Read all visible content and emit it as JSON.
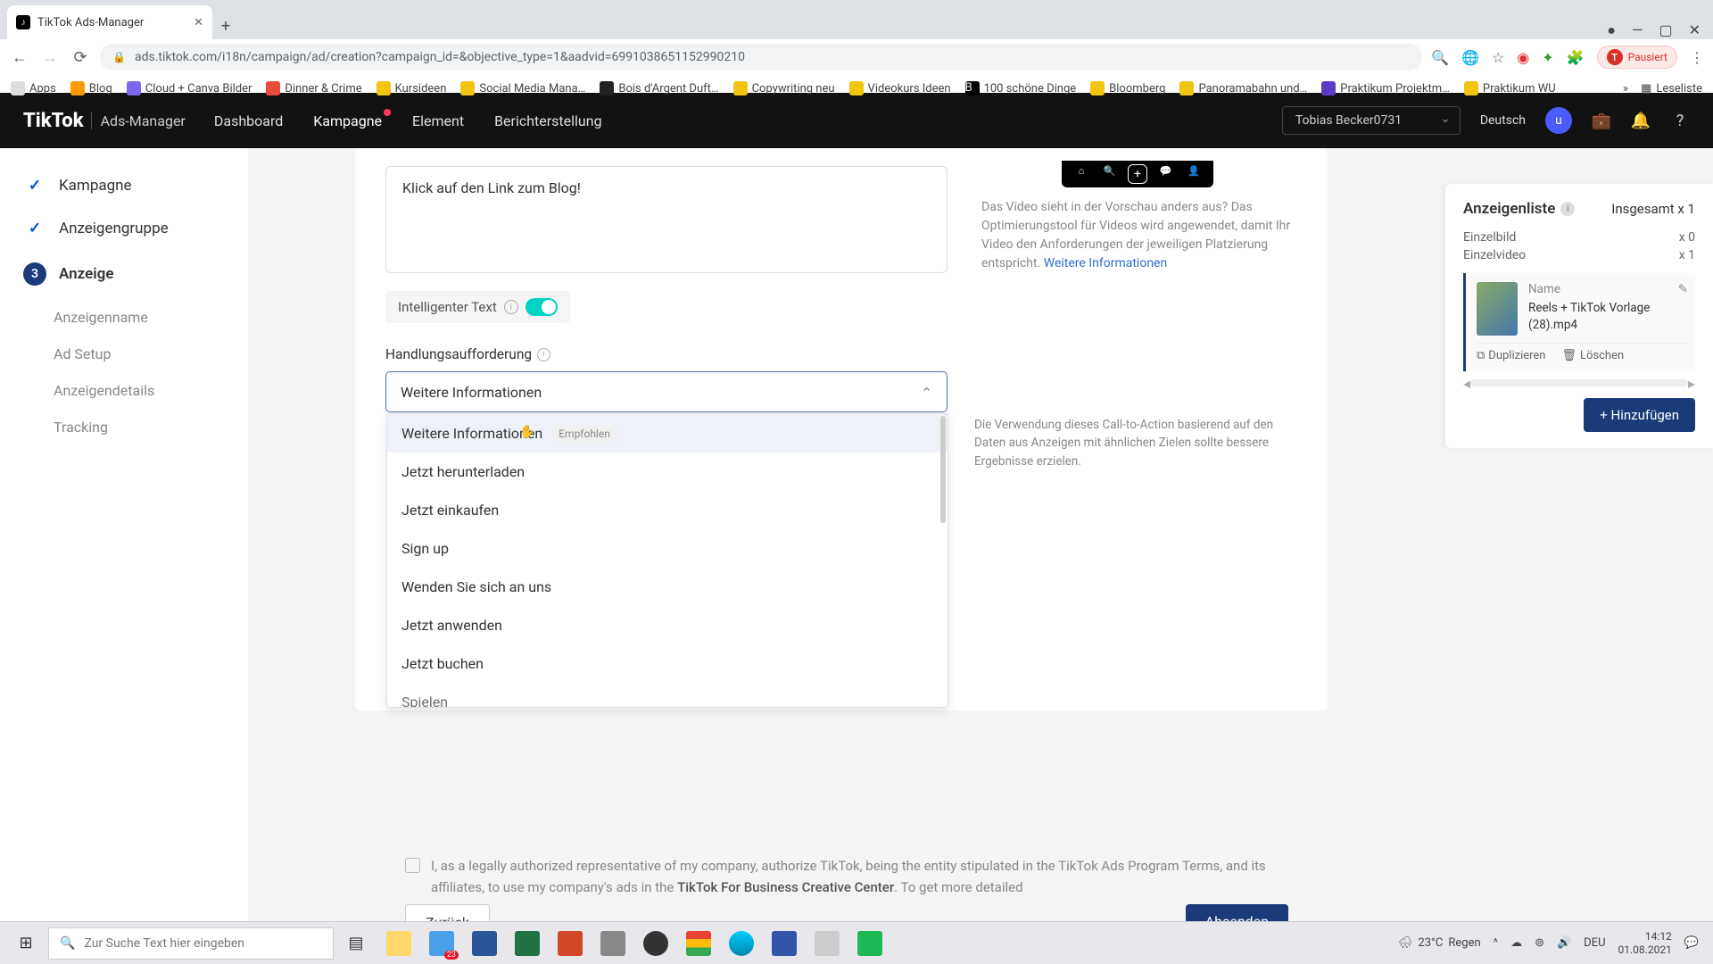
{
  "browser": {
    "tab_title": "TikTok Ads-Manager",
    "url": "ads.tiktok.com/i18n/campaign/ad/creation?campaign_id=&objective_type=1&aadvid=6991038651152990210",
    "profile_status": "Pausiert",
    "bookmarks": [
      "Apps",
      "Blog",
      "Cloud + Canva Bilder",
      "Dinner & Crime",
      "Kursideen",
      "Social Media Mana…",
      "Bois d'Argent Duft…",
      "Copywriting neu",
      "Videokurs Ideen",
      "100 schöne Dinge",
      "Bloomberg",
      "Panoramabahn und…",
      "Praktikum Projektm…",
      "Praktikum WU"
    ],
    "reading_list": "Leseliste"
  },
  "header": {
    "logo_main": "TikTok",
    "logo_sub": "Ads-Manager",
    "nav": [
      "Dashboard",
      "Kampagne",
      "Element",
      "Berichterstellung"
    ],
    "account": "Tobias Becker0731",
    "language": "Deutsch",
    "avatar_initial": "u"
  },
  "sidebar": {
    "steps": [
      {
        "label": "Kampagne",
        "state": "done"
      },
      {
        "label": "Anzeigengruppe",
        "state": "done"
      },
      {
        "label": "Anzeige",
        "state": "active",
        "num": "3"
      }
    ],
    "subs": [
      "Anzeigenname",
      "Ad Setup",
      "Anzeigendetails",
      "Tracking"
    ]
  },
  "form": {
    "text_value": "Klick auf den Link zum Blog!",
    "smart_text_label": "Intelligenter Text",
    "cta_label": "Handlungsaufforderung",
    "cta_selected": "Weitere Informationen",
    "cta_options": [
      {
        "label": "Weitere Informationen",
        "recommended": "Empfohlen",
        "hl": true
      },
      {
        "label": "Jetzt herunterladen"
      },
      {
        "label": "Jetzt einkaufen"
      },
      {
        "label": "Sign up"
      },
      {
        "label": "Wenden Sie sich an uns"
      },
      {
        "label": "Jetzt anwenden"
      },
      {
        "label": "Jetzt buchen"
      },
      {
        "label": "Spielen"
      }
    ],
    "cta_tip": "Die Verwendung dieses Call-to-Action basierend auf den Daten aus Anzeigen mit ähnlichen Zielen sollte bessere Ergebnisse erzielen."
  },
  "preview": {
    "note_prefix": "Das Video sieht in der Vorschau anders aus? Das Optimierungstool für Videos wird angewendet, damit Ihr Video den Anforderungen der jeweiligen Platzierung entspricht. ",
    "note_link": "Weitere Informationen"
  },
  "adlist": {
    "title": "Anzeigenliste",
    "total_label": "Insgesamt x 1",
    "stats": [
      {
        "k": "Einzelbild",
        "v": "x 0"
      },
      {
        "k": "Einzelvideo",
        "v": "x 1"
      }
    ],
    "item": {
      "name_label": "Name",
      "name": "Reels + TikTok Vorlage (28).mp4",
      "duplicate": "Duplizieren",
      "delete": "Löschen"
    },
    "add_button": "+ Hinzufügen"
  },
  "consent": {
    "text_a": "I, as a legally authorized representative of my company, authorize TikTok, being the entity stipulated in the TikTok Ads Program Terms, and its affiliates, to use my company's ads in the ",
    "link": "TikTok For Business Creative Center",
    "text_b": ". To get more detailed"
  },
  "buttons": {
    "back": "Zurück",
    "submit": "Absenden"
  },
  "taskbar": {
    "search_placeholder": "Zur Suche Text hier eingeben",
    "weather_temp": "23°C",
    "weather_cond": "Regen",
    "lang": "DEU",
    "time": "14:12",
    "date": "01.08.2021",
    "mail_badge": "23"
  }
}
